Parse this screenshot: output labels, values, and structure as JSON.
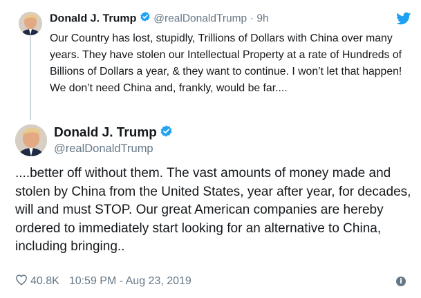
{
  "quoted": {
    "name": "Donald J. Trump",
    "handle": "@realDonaldTrump",
    "separator": "·",
    "time": "9h",
    "text": "Our Country has lost, stupidly, Trillions of Dollars with China over many years. They have stolen our Intellectual Property at a rate of Hundreds of Billions of Dollars a year, & they want to continue. I won’t let that happen! We don’t need China and, frankly, would be far...."
  },
  "main": {
    "name": "Donald J. Trump",
    "handle": "@realDonaldTrump",
    "text": "....better off without them. The vast amounts of money made and stolen by China from the United States, year after year, for decades, will and must STOP. Our great American companies are hereby ordered to immediately start looking for an alternative to China, including bringing.."
  },
  "footer": {
    "likes": "40.8K",
    "timestamp": "10:59 PM - Aug 23, 2019",
    "info_glyph": "i"
  },
  "colors": {
    "twitter_blue": "#1da1f2",
    "muted": "#657786"
  },
  "icons": [
    "twitter-bird-icon",
    "verified-badge-icon",
    "heart-icon",
    "info-icon"
  ]
}
